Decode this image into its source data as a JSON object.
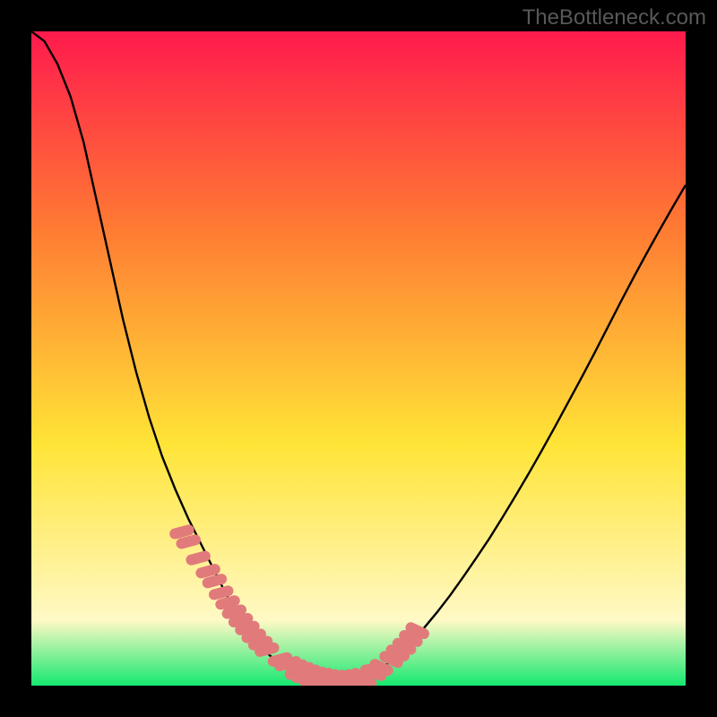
{
  "watermark": "TheBottleneck.com",
  "colors": {
    "black": "#000000",
    "grad_stop1": "#ff1a4d",
    "grad_stop2": "#ff7a33",
    "grad_stop3": "#ffe437",
    "grad_stop4": "#fff9c5",
    "grad_stop5": "#15e870",
    "curve": "#000000",
    "marker": "#e17b7b"
  },
  "chart_data": {
    "type": "line",
    "title": "",
    "xlabel": "",
    "ylabel": "",
    "xlim": [
      0,
      100
    ],
    "ylim": [
      0,
      100
    ],
    "x": [
      0,
      2,
      4,
      6,
      8,
      10,
      12,
      14,
      16,
      18,
      20,
      22,
      24,
      26,
      28,
      30,
      31,
      32,
      34,
      36,
      38,
      40,
      42,
      44,
      46,
      48,
      50,
      52,
      54,
      56,
      58,
      60,
      62,
      64,
      66,
      68,
      70,
      72,
      74,
      76,
      78,
      80,
      82,
      84,
      86,
      88,
      90,
      92,
      94,
      96,
      98,
      100
    ],
    "values": [
      100,
      98.5,
      95,
      90,
      83,
      74,
      65,
      56,
      48,
      41,
      35,
      30,
      25.5,
      21.5,
      17.5,
      13.5,
      11.5,
      9.8,
      7.2,
      5,
      3.3,
      2,
      1.1,
      0.5,
      0.2,
      0.2,
      0.7,
      1.6,
      3,
      4.7,
      6.6,
      8.8,
      11.2,
      13.8,
      16.6,
      19.5,
      22.5,
      25.7,
      29,
      32.4,
      35.9,
      39.5,
      43.2,
      46.9,
      50.7,
      54.6,
      58.5,
      62.3,
      66,
      69.6,
      73.1,
      76.5
    ],
    "markers_x": [
      23,
      24,
      25.5,
      27,
      28,
      29,
      30,
      31,
      32,
      33,
      34,
      35,
      36,
      38,
      39,
      40,
      41,
      42,
      43,
      44,
      45,
      46,
      47,
      48,
      49,
      50,
      51.5,
      52.5,
      53.5,
      55,
      56,
      57,
      58,
      59
    ],
    "markers_y": [
      23.5,
      22,
      19.5,
      17.5,
      16,
      14.2,
      12.7,
      11.3,
      10,
      8.8,
      7.6,
      6.5,
      5.5,
      4,
      3.3,
      2.7,
      2.2,
      1.8,
      1.4,
      1.1,
      0.9,
      0.7,
      0.6,
      0.6,
      0.7,
      0.9,
      1.4,
      2,
      2.8,
      4,
      5,
      6,
      7.2,
      8.4
    ]
  }
}
